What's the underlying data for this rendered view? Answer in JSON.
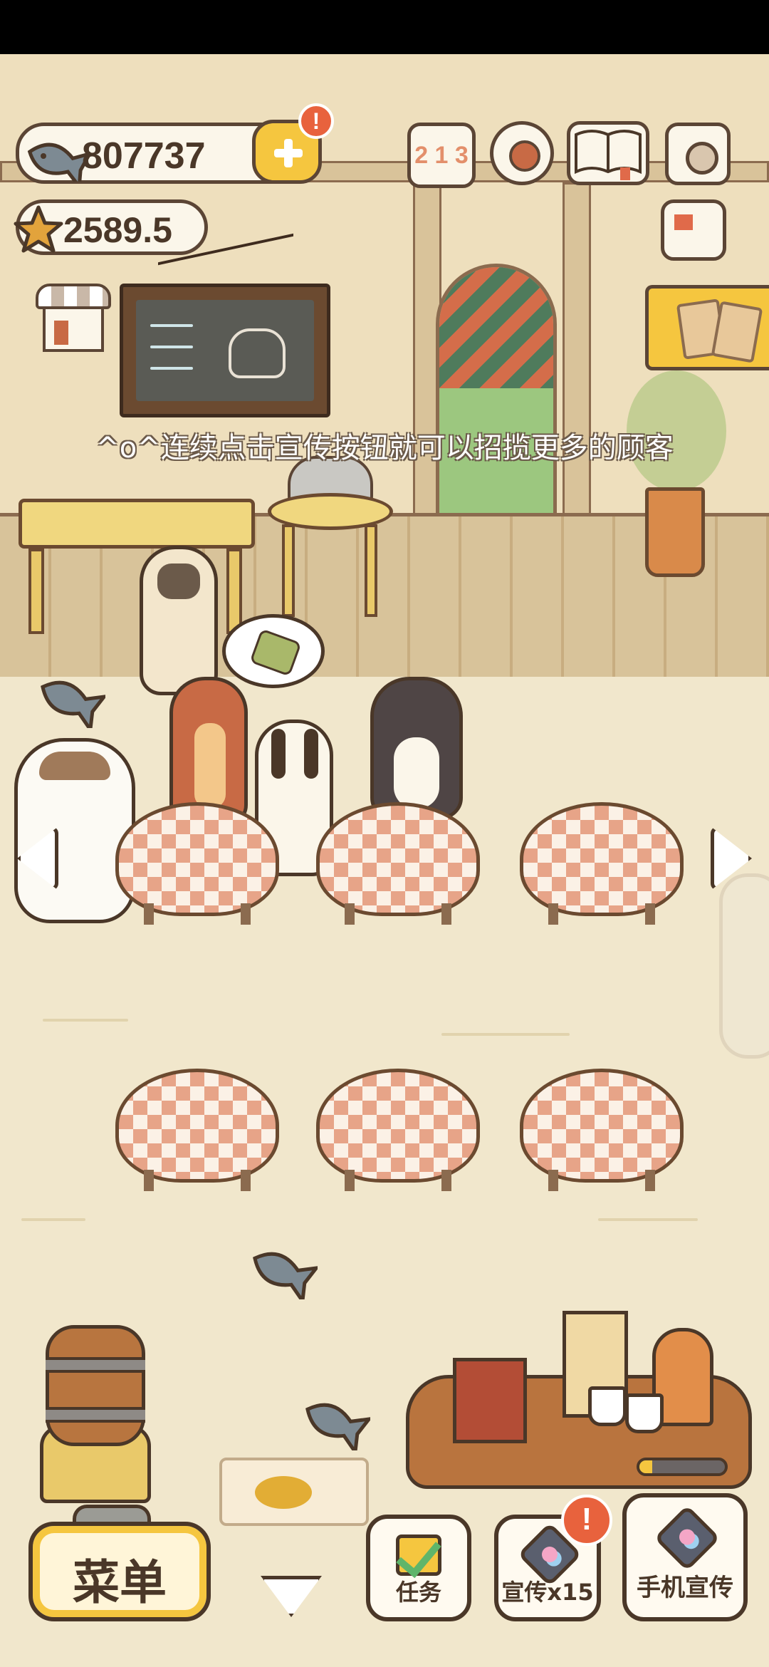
{
  "hud": {
    "fish_count": "807737",
    "star_count": "2589.5",
    "add_alert": "!",
    "rank_digits": "2 1 3"
  },
  "tip": "^o^连续点击宣传按钮就可以招揽更多的顾客",
  "bottom_bar": {
    "menu_label": "菜单",
    "task_label": "任务",
    "promo_label": "宣传x15",
    "promo_alert": "!",
    "phone_promo_label": "手机宣传"
  },
  "brew_progress": 0.15,
  "colors": {
    "accent_yellow": "#f5c63f",
    "alert_red": "#e8623d",
    "outline_brown": "#4a3728",
    "tablecloth": "#e7a488"
  },
  "icons": [
    "fish-icon",
    "star-icon",
    "plus-icon",
    "rank-icon",
    "settings-icon",
    "book-icon",
    "camera-icon",
    "news-icon",
    "shop-icon",
    "cookie-icon",
    "left-arrow-icon",
    "right-arrow-icon",
    "collapse-arrow-icon",
    "checklist-icon",
    "megaphone-icon"
  ]
}
